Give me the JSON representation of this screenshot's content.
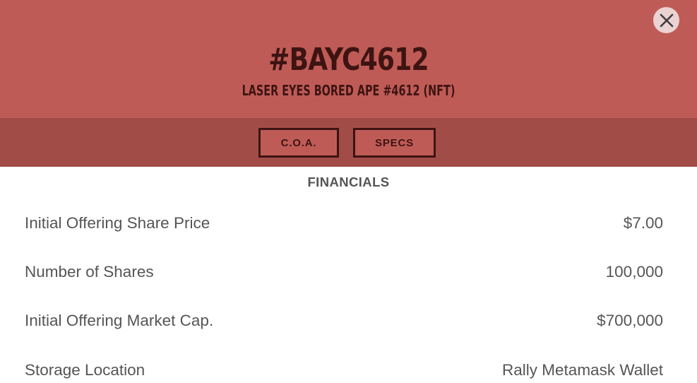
{
  "header": {
    "title": "#BAYC4612",
    "subtitle": "LASER EYES BORED APE #4612 (NFT)",
    "close_icon": "close-icon"
  },
  "tabs": [
    {
      "label": "C.O.A."
    },
    {
      "label": "SPECS"
    }
  ],
  "financials": {
    "title": "FINANCIALS",
    "rows": [
      {
        "label": "Initial Offering Share Price",
        "value": "$7.00"
      },
      {
        "label": "Number of Shares",
        "value": "100,000"
      },
      {
        "label": "Initial Offering Market Cap.",
        "value": "$700,000"
      },
      {
        "label": "Storage Location",
        "value": "Rally Metamask Wallet"
      }
    ]
  },
  "colors": {
    "header_bg": "#bf5b56",
    "tabbar_bg": "#a24c48",
    "dark_text": "#3d1412",
    "body_text": "#555555"
  }
}
